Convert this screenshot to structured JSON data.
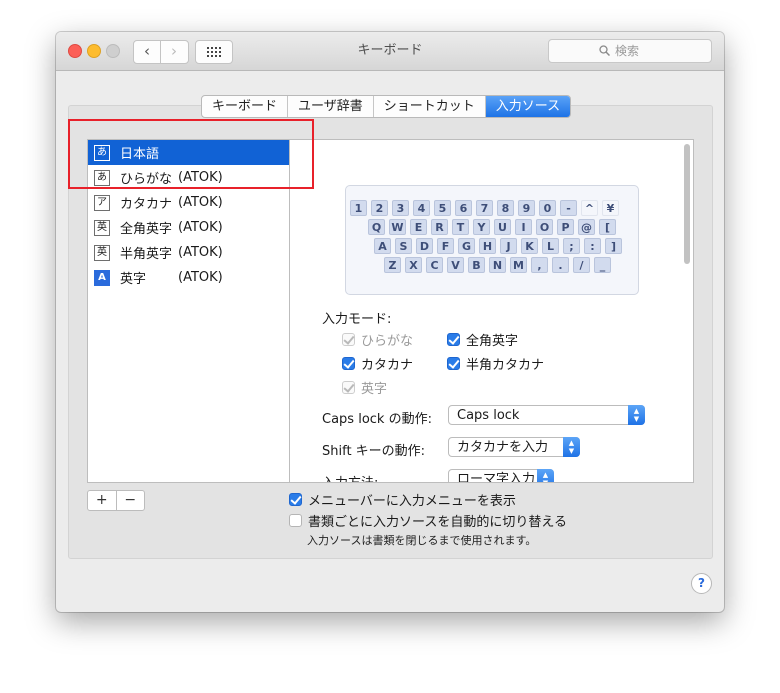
{
  "window": {
    "title": "キーボード",
    "search_placeholder": "検索"
  },
  "toolbar": {
    "back": "‹",
    "forward": "›"
  },
  "tabs": [
    {
      "label": "キーボード"
    },
    {
      "label": "ユーザ辞書"
    },
    {
      "label": "ショートカット"
    },
    {
      "label": "入力ソース"
    }
  ],
  "sources": [
    {
      "icon": "あ",
      "name": "日本語",
      "suffix": ""
    },
    {
      "icon": "あ",
      "name": "ひらがな",
      "suffix": "(ATOK)"
    },
    {
      "icon": "ア",
      "name": "カタカナ",
      "suffix": "(ATOK)"
    },
    {
      "icon": "英",
      "name": "全角英字",
      "suffix": "(ATOK)"
    },
    {
      "icon": "英",
      "name": "半角英字",
      "suffix": "(ATOK)"
    },
    {
      "icon": "A",
      "name": "英字",
      "suffix": "(ATOK)"
    }
  ],
  "keyboard": {
    "row1": [
      "1",
      "2",
      "3",
      "4",
      "5",
      "6",
      "7",
      "8",
      "9",
      "0",
      "-",
      "^",
      "¥"
    ],
    "row2": [
      "Q",
      "W",
      "E",
      "R",
      "T",
      "Y",
      "U",
      "I",
      "O",
      "P",
      "@",
      "["
    ],
    "row3": [
      "A",
      "S",
      "D",
      "F",
      "G",
      "H",
      "J",
      "K",
      "L",
      ";",
      ":",
      "]"
    ],
    "row4": [
      "Z",
      "X",
      "C",
      "V",
      "B",
      "N",
      "M",
      ",",
      ".",
      "/",
      "_"
    ]
  },
  "input_modes": {
    "label": "入力モード:",
    "hiragana": "ひらがな",
    "zenkaku_eiji": "全角英字",
    "katakana": "カタカナ",
    "hankaku_katakana": "半角カタカナ",
    "eiji": "英字"
  },
  "caps_lock": {
    "label": "Caps lock の動作:",
    "value": "Caps lock"
  },
  "shift": {
    "label": "Shift キーの動作:",
    "value": "カタカナを入力"
  },
  "input_method": {
    "label": "入力方法:",
    "value": "ローマ字入力"
  },
  "buttons": {
    "add": "+",
    "remove": "−",
    "help": "?"
  },
  "options": {
    "show_menu": "メニューバーに入力メニューを表示",
    "auto_switch": "書類ごとに入力ソースを自動的に切り替える",
    "note": "入力ソースは書類を閉じるまで使用されます。"
  },
  "colors": {
    "accent": "#1162d5",
    "highlight_box": "#e8212a"
  }
}
